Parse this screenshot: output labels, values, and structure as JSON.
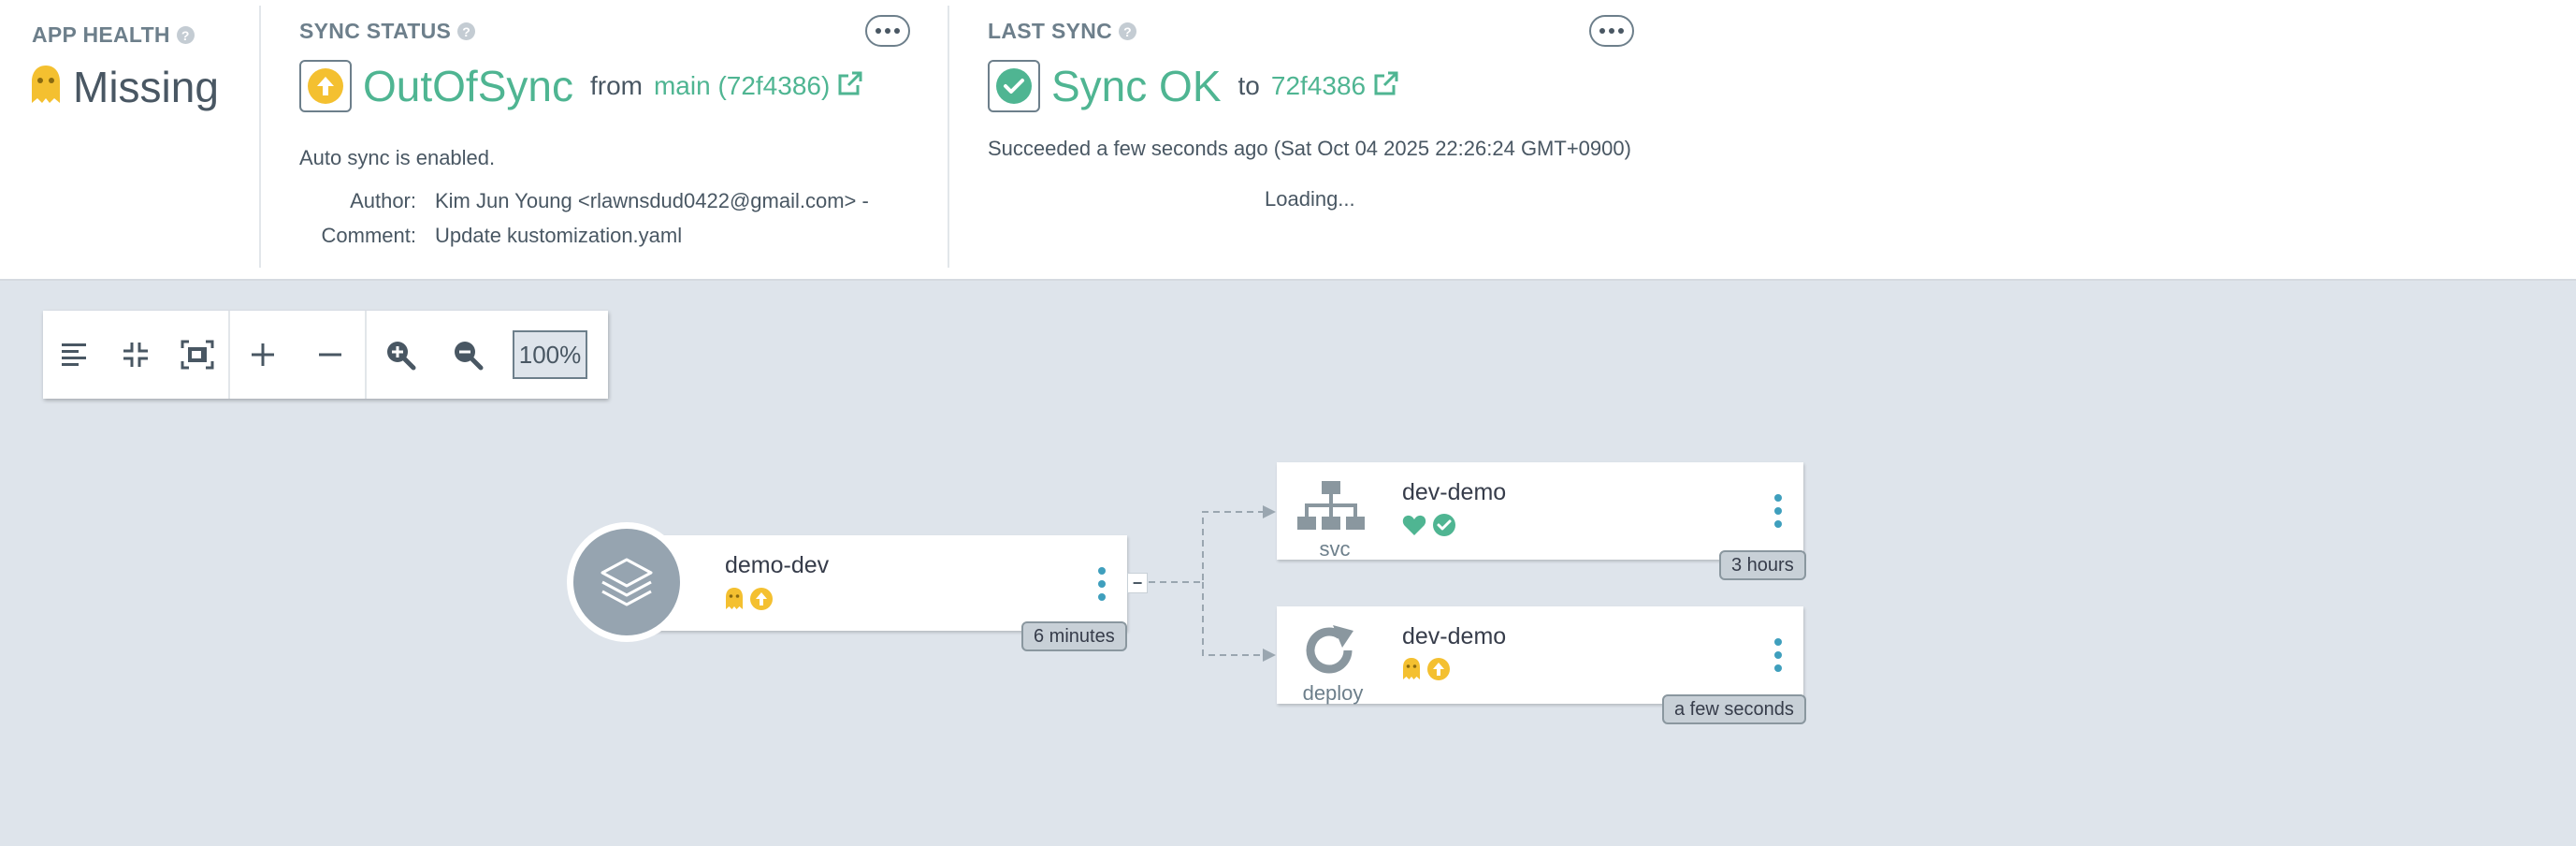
{
  "app_health": {
    "title": "APP HEALTH",
    "help": "?",
    "value": "Missing",
    "icon": "ghost-icon",
    "icon_color": "#f4c030"
  },
  "sync_status": {
    "title": "SYNC STATUS",
    "help": "?",
    "value": "OutOfSync",
    "from_word": "from",
    "revision": "main (72f4386)",
    "auto_sync": "Auto sync is enabled.",
    "author_label": "Author:",
    "author_value": "Kim Jun Young <rlawnsdud0422@gmail.com> -",
    "comment_label": "Comment:",
    "comment_value": "Update kustomization.yaml"
  },
  "last_sync": {
    "title": "LAST SYNC",
    "help": "?",
    "value": "Sync OK",
    "to_word": "to",
    "revision": "72f4386",
    "succeeded": "Succeeded a few seconds ago (Sat Oct 04 2025 22:26:24 GMT+0900)",
    "loading": "Loading..."
  },
  "toolbar": {
    "zoom": "100%",
    "buttons": [
      "align-left-icon",
      "compress-icon",
      "fit-screen-icon",
      "plus-icon",
      "minus-icon",
      "zoom-in-icon",
      "zoom-out-icon"
    ]
  },
  "graph": {
    "app_node": {
      "name": "demo-dev",
      "age": "6 minutes",
      "kind_icon": "layers-icon"
    },
    "svc_node": {
      "name": "dev-demo",
      "kind": "svc",
      "age": "3 hours"
    },
    "deploy_node": {
      "name": "dev-demo",
      "kind": "deploy",
      "age": "a few seconds"
    },
    "collapse": "−"
  },
  "colors": {
    "green": "#4fb592",
    "yellow": "#f4c030",
    "kebab": "#3f9fbd",
    "background": "#dee4eb"
  }
}
